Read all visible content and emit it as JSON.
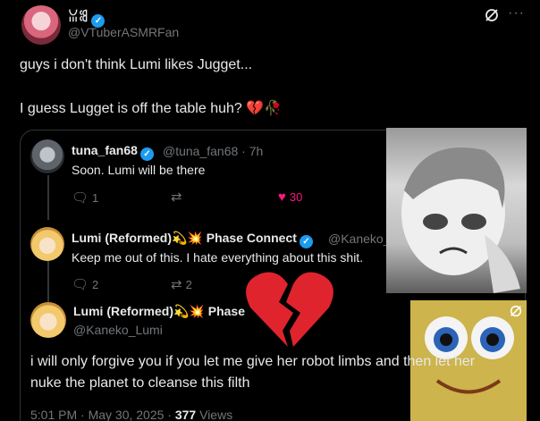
{
  "author": {
    "display_name": "ꈍꌃ",
    "handle": "@VTuberASMRFan"
  },
  "post": {
    "line1": "guys i don't think Lumi likes Jugget...",
    "line2": "I guess Lugget is off the table huh? 💔🥀"
  },
  "quote": {
    "reply1": {
      "name": "tuna_fan68",
      "handle": "@tuna_fan68",
      "time": "· 7h",
      "text": "Soon. Lumi will be there",
      "replies": "1",
      "likes": "30"
    },
    "reply2": {
      "name": "Lumi (Reformed)💫💥 Phase Connect",
      "handle": "@Kaneko_",
      "text": "Keep me out of this. I hate everything about this shit.",
      "replies": "2",
      "reposts": "2"
    },
    "reply3": {
      "name": "Lumi (Reformed)💫💥 Phase",
      "handle": "@Kaneko_Lumi",
      "text_line1": "i will only forgive you if you let me give her robot limbs and then let her",
      "text_line2": "nuke the planet to cleanse this filth",
      "timestamp": "5:01 PM · May 30, 2025 · ",
      "views": "377",
      "views_label": " Views"
    }
  },
  "colors": {
    "accent": "#1d9bf0",
    "like": "#f91880",
    "muted": "#71767b",
    "text": "#e7e9ea",
    "border": "#2f3336"
  },
  "icons": [
    "grok-icon",
    "more-icon",
    "verified-icon",
    "reply-icon",
    "repost-icon",
    "like-icon",
    "broken-heart-icon"
  ]
}
